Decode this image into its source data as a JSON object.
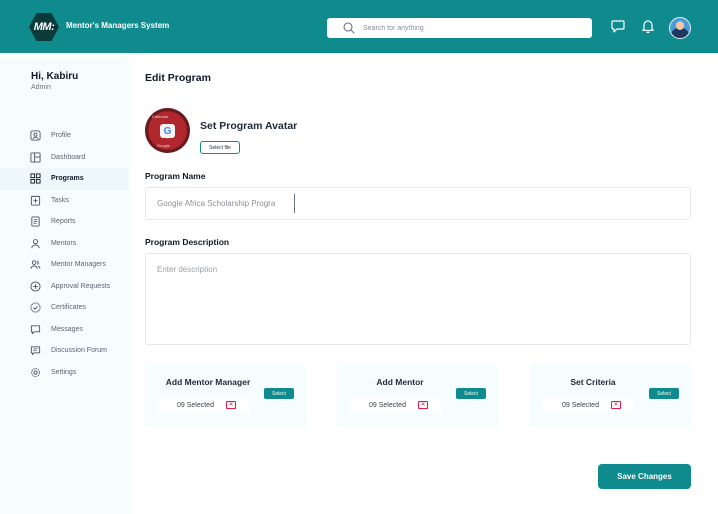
{
  "header": {
    "logo_text": "MM:",
    "brand": "Mentor's Managers System",
    "search_placeholder": "Search for anything",
    "accent": "#0f8b8d"
  },
  "sidebar": {
    "greeting": "Hi, Kabiru",
    "role": "Admin",
    "items": [
      {
        "label": "Profile",
        "icon": "user-square-icon",
        "active": false
      },
      {
        "label": "Dashboard",
        "icon": "dashboard-icon",
        "active": false
      },
      {
        "label": "Programs",
        "icon": "programs-icon",
        "active": true
      },
      {
        "label": "Tasks",
        "icon": "tasks-icon",
        "active": false
      },
      {
        "label": "Reports",
        "icon": "reports-icon",
        "active": false
      },
      {
        "label": "Mentors",
        "icon": "user-icon",
        "active": false
      },
      {
        "label": "Mentor Managers",
        "icon": "users-icon",
        "active": false
      },
      {
        "label": "Approval Requests",
        "icon": "plus-circle-icon",
        "active": false
      },
      {
        "label": "Certificates",
        "icon": "badge-check-icon",
        "active": false
      },
      {
        "label": "Messages",
        "icon": "message-icon",
        "active": false
      },
      {
        "label": "Discussion Forum",
        "icon": "forum-icon",
        "active": false
      },
      {
        "label": "Settings",
        "icon": "gear-icon",
        "active": false
      }
    ]
  },
  "main": {
    "title": "Edit Program",
    "avatar": {
      "label": "Set Program Avatar",
      "button": "Select file",
      "image_text_top": "Calendar",
      "image_text_center": "G",
      "image_text_bottom": "Google"
    },
    "program_name": {
      "label": "Program Name",
      "value": "Google Africa Scholarship Progra"
    },
    "program_description": {
      "label": "Program Description",
      "placeholder": "Enter description"
    },
    "cards": [
      {
        "title": "Add Mentor Manager",
        "count": "09 Selected",
        "button": "Select"
      },
      {
        "title": "Add Mentor",
        "count": "09 Selected",
        "button": "Select"
      },
      {
        "title": "Set Criteria",
        "count": "09 Selected",
        "button": "Select"
      }
    ],
    "save_label": "Save Changes"
  }
}
